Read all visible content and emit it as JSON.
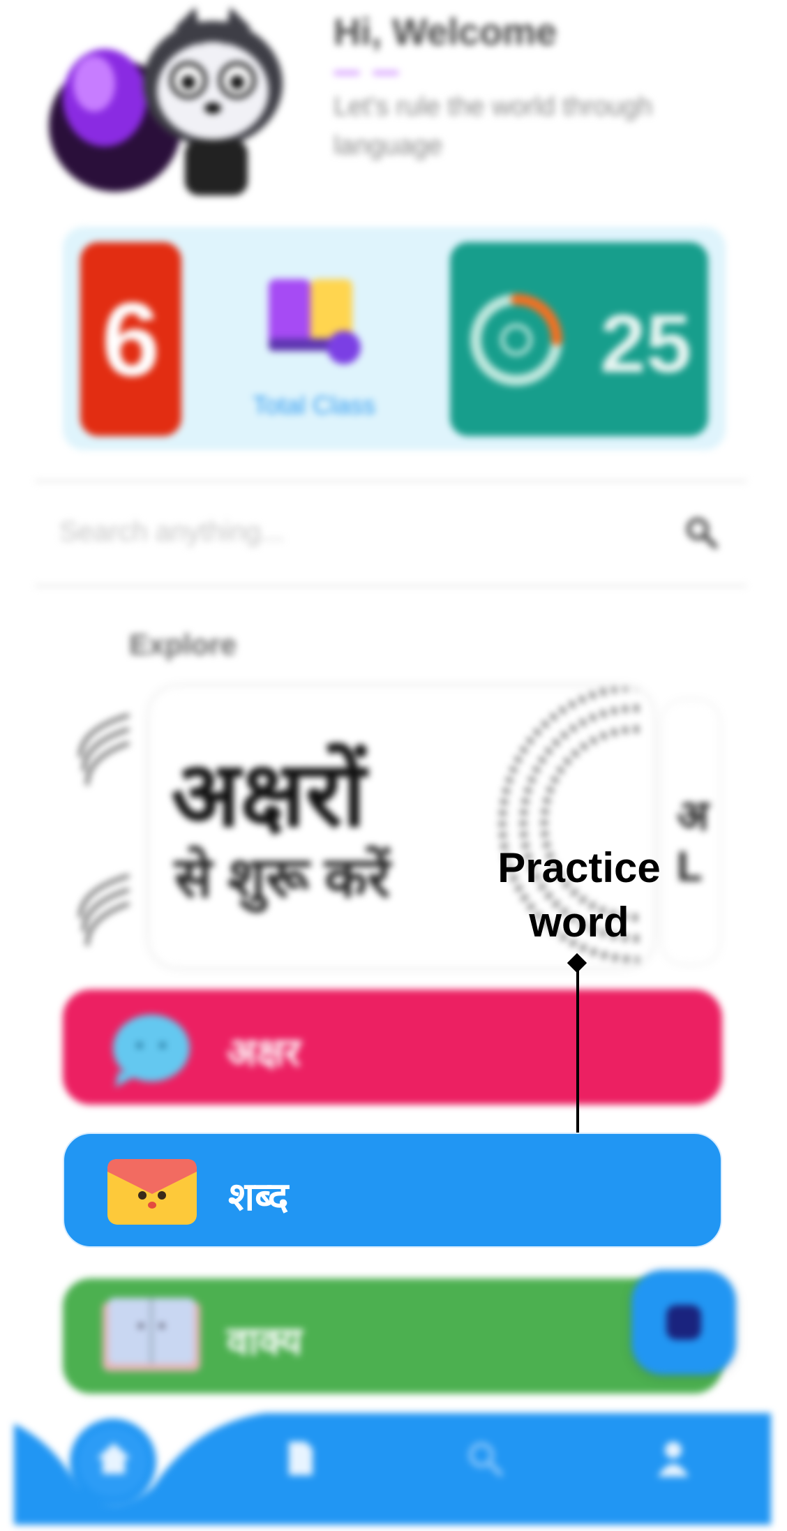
{
  "header": {
    "greeting": "Hi, Welcome",
    "tagline": "Let's rule the world through language"
  },
  "stats": {
    "count_value": "6",
    "total_class_label": "Total Class",
    "progress_value": "25",
    "progress_fraction": 0.25
  },
  "search": {
    "placeholder": "Search anything..."
  },
  "explore": {
    "title": "Explore",
    "card_title": "अक्षरों",
    "card_subtitle": "से शुरू करें"
  },
  "menu": {
    "items": [
      {
        "label": "अक्षर",
        "color": "#ec2062"
      },
      {
        "label": "शब्द",
        "color": "#2196f3"
      },
      {
        "label": "वाक्य",
        "color": "#4cb050"
      }
    ]
  },
  "callout": {
    "text": "Practice word"
  },
  "nav": {
    "items": [
      {
        "icon": "home-icon"
      },
      {
        "icon": "document-icon"
      },
      {
        "icon": "search-icon"
      },
      {
        "icon": "person-icon"
      }
    ]
  },
  "colors": {
    "primary_blue": "#2196f3",
    "pink": "#ec2062",
    "green": "#4cb050",
    "teal": "#179e8c",
    "red": "#e22d12"
  }
}
